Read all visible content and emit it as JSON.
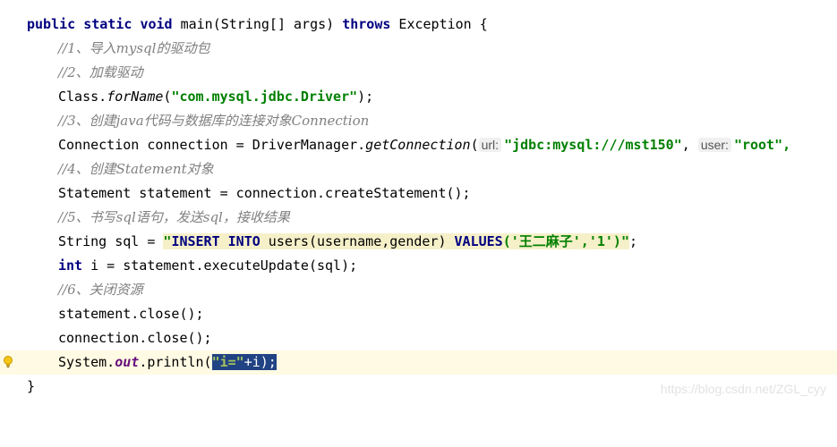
{
  "editor": {
    "method_signature": {
      "kw_public": "public",
      "kw_static": "static",
      "kw_void": "void",
      "text": " main(String[] args) ",
      "kw_throws": "throws",
      "tail": " Exception {"
    },
    "comment_1": "//1、导入mysql的驱动包",
    "comment_2": "//2、加载驱动",
    "class_forname": {
      "prefix": "Class.",
      "method": "forName",
      "open": "(",
      "string": "\"com.mysql.jdbc.Driver\"",
      "close": ");"
    },
    "comment_3": "//3、创建java代码与数据库的连接对象Connection",
    "connection_line": {
      "prefix": "Connection connection = DriverManager.",
      "method": "getConnection",
      "open": "(",
      "hint_url": "url:",
      "url_string": "\"jdbc:mysql:///mst150\"",
      "comma": ", ",
      "hint_user": "user:",
      "user_string": "\"root\","
    },
    "comment_4": "//4、创建Statement对象",
    "statement_line": "Statement statement = connection.createStatement();",
    "comment_5": "//5、书写sql语句，发送sql，接收结果",
    "sql_line": {
      "prefix": "String sql = ",
      "quote_open": "\"",
      "sql_kw_1": "INSERT INTO",
      "sql_mid": " users(username,gender) ",
      "sql_kw_2": "VALUES",
      "sql_tail": "('王二麻子','1')",
      "quote_close": "\"",
      "end": ";"
    },
    "update_line": {
      "kw_int": "int",
      "rest": " i = statement.executeUpdate(sql);"
    },
    "comment_6": "//6、关闭资源",
    "close_statement": "statement.close();",
    "close_connection": "connection.close();",
    "println_line": {
      "prefix": "System.",
      "field": "out",
      "method": ".println(",
      "sel_string": "\"i=\"",
      "sel_rest": "+i);"
    },
    "closing_brace": "}"
  },
  "icons": {
    "gutter": "lightbulb-icon"
  },
  "colors": {
    "keyword": "#000080",
    "string": "#008000",
    "comment": "#808080",
    "current_line": "#fffae3",
    "selection": "#214283"
  },
  "watermark": "https://blog.csdn.net/ZGL_cyy"
}
